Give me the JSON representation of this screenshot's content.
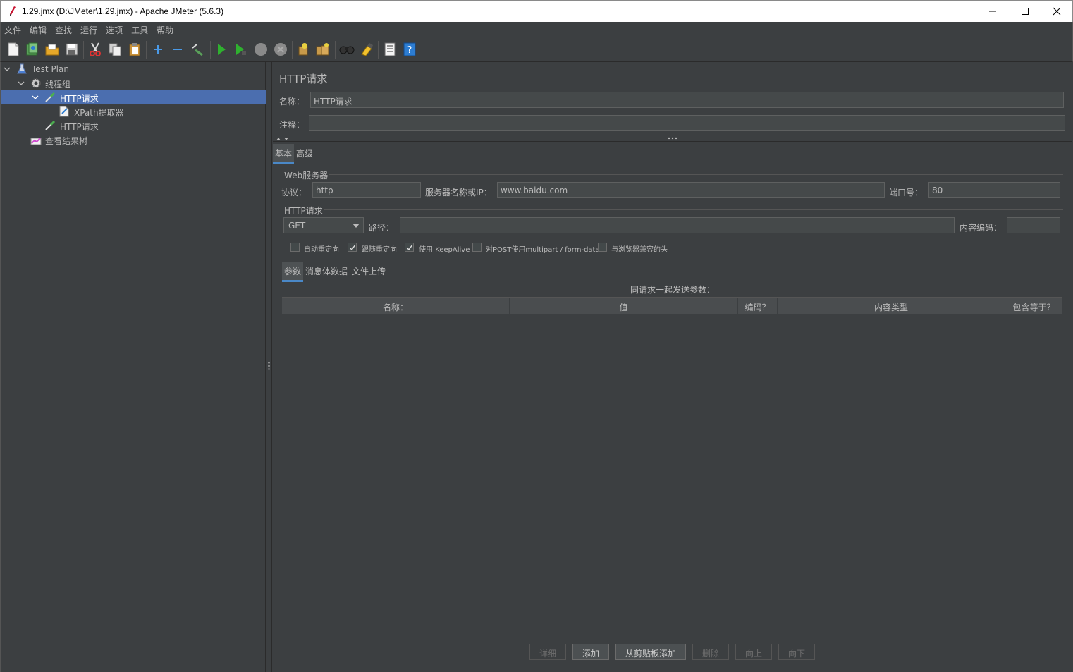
{
  "window": {
    "title": "1.29.jmx (D:\\JMeter\\1.29.jmx) - Apache JMeter (5.6.3)"
  },
  "menu": [
    "文件",
    "编辑",
    "查找",
    "运行",
    "选项",
    "工具",
    "帮助"
  ],
  "toolbar_icons": [
    "new-icon",
    "templates-icon",
    "open-icon",
    "save-icon",
    "cut-icon",
    "copy-icon",
    "paste-icon",
    "expand-icon",
    "collapse-icon",
    "toggle-icon",
    "start-icon",
    "start-no-pause-icon",
    "stop-icon",
    "shutdown-icon",
    "clear-icon",
    "clear-all-icon",
    "search-icon",
    "reset-search-icon",
    "function-helper-icon",
    "help-icon"
  ],
  "tree": {
    "items": [
      {
        "label": "Test Plan",
        "icon": "test-plan-icon",
        "expanded": true,
        "selected": false
      },
      {
        "label": "线程组",
        "icon": "thread-group-gear-icon",
        "expanded": true,
        "selected": false
      },
      {
        "label": "HTTP请求",
        "icon": "http-sampler-pipette-icon",
        "expanded": true,
        "selected": true
      },
      {
        "label": "XPath提取器",
        "icon": "xpath-extractor-icon",
        "selected": false
      },
      {
        "label": "HTTP请求",
        "icon": "http-sampler-pipette-icon",
        "selected": false
      },
      {
        "label": "查看结果树",
        "icon": "results-tree-icon",
        "selected": false
      }
    ]
  },
  "panel": {
    "title": "HTTP请求",
    "name_label": "名称：",
    "name_value": "HTTP请求",
    "comment_label": "注释：",
    "comment_value": "",
    "tabs": [
      "基本",
      "高级"
    ],
    "web_server": {
      "group_title": "Web服务器",
      "protocol_label": "协议：",
      "protocol_value": "http",
      "server_label": "服务器名称或IP：",
      "server_value": "www.baidu.com",
      "port_label": "端口号：",
      "port_value": "80"
    },
    "http_request": {
      "group_title": "HTTP请求",
      "method": "GET",
      "path_label": "路径：",
      "path_value": "",
      "encoding_label": "内容编码：",
      "encoding_value": ""
    },
    "options": [
      {
        "label": "自动重定向",
        "checked": false
      },
      {
        "label": "跟随重定向",
        "checked": true
      },
      {
        "label": "使用 KeepAlive",
        "checked": true
      },
      {
        "label": "对POST使用multipart / form-data",
        "checked": false
      },
      {
        "label": "与浏览器兼容的头",
        "checked": false
      }
    ],
    "sub_tabs": [
      "参数",
      "消息体数据",
      "文件上传"
    ],
    "table": {
      "caption": "同请求一起发送参数：",
      "columns": [
        "名称：",
        "值",
        "编码？",
        "内容类型",
        "包含等于？"
      ],
      "rows": []
    },
    "buttons": [
      {
        "label": "详细",
        "enabled": false
      },
      {
        "label": "添加",
        "enabled": true
      },
      {
        "label": "从剪贴板添加",
        "enabled": true
      },
      {
        "label": "删除",
        "enabled": false
      },
      {
        "label": "向上",
        "enabled": false
      },
      {
        "label": "向下",
        "enabled": false
      }
    ]
  }
}
